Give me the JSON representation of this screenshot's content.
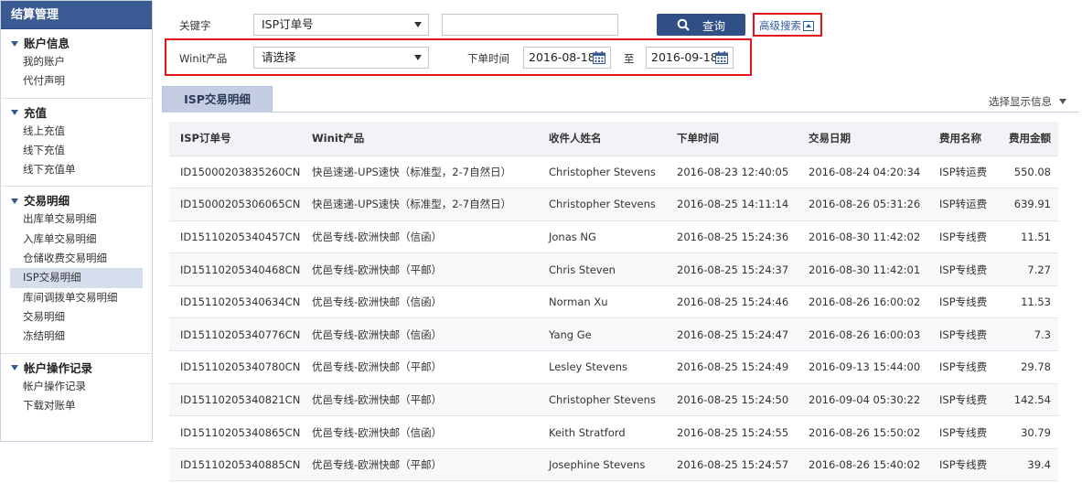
{
  "sidebar": {
    "title": "结算管理",
    "groups": [
      {
        "title": "账户信息",
        "items": [
          "我的账户",
          "代付声明"
        ]
      },
      {
        "title": "充值",
        "items": [
          "线上充值",
          "线下充值",
          "线下充值单"
        ]
      },
      {
        "title": "交易明细",
        "items": [
          "出库单交易明细",
          "入库单交易明细",
          "仓储收费交易明细",
          "ISP交易明细",
          "库间调拨单交易明细",
          "交易明细",
          "冻结明细"
        ]
      },
      {
        "title": "帐户操作记录",
        "items": [
          "帐户操作记录",
          "下载对账单"
        ]
      }
    ],
    "active_item": "ISP交易明细"
  },
  "filters": {
    "keyword_label": "关键字",
    "keyword_select": "ISP订单号",
    "keyword_value": "",
    "search_button": "查询",
    "advanced_search": "高级搜索",
    "product_label": "Winit产品",
    "product_select": "请选择",
    "order_time_label": "下单时间",
    "date_from": "2016-08-18",
    "to_label": "至",
    "date_to": "2016-09-18"
  },
  "tabs": {
    "active": "ISP交易明细",
    "display_info": "选择显示信息"
  },
  "table": {
    "columns": [
      "ISP订单号",
      "Winit产品",
      "收件人姓名",
      "下单时间",
      "交易日期",
      "费用名称",
      "费用金额"
    ],
    "rows": [
      [
        "ID15000203835260CN",
        "快邑速递-UPS速快（标准型，2-7自然日）",
        "Christopher Stevens",
        "2016-08-23 12:40:05",
        "2016-08-24 04:20:34",
        "ISP转运费",
        "550.08"
      ],
      [
        "ID15000205306065CN",
        "快邑速递-UPS速快（标准型，2-7自然日）",
        "Christopher Stevens",
        "2016-08-25 14:11:14",
        "2016-08-26 05:31:26",
        "ISP转运费",
        "639.91"
      ],
      [
        "ID15110205340457CN",
        "优邑专线-欧洲快邮（信函）",
        "Jonas NG",
        "2016-08-25 15:24:36",
        "2016-08-30 11:42:02",
        "ISP专线费",
        "11.51"
      ],
      [
        "ID15110205340468CN",
        "优邑专线-欧洲快邮（平邮）",
        "Chris Steven",
        "2016-08-25 15:24:37",
        "2016-08-30 11:42:01",
        "ISP专线费",
        "7.27"
      ],
      [
        "ID15110205340634CN",
        "优邑专线-欧洲快邮（信函）",
        "Norman Xu",
        "2016-08-25 15:24:46",
        "2016-08-26 16:00:02",
        "ISP专线费",
        "11.53"
      ],
      [
        "ID15110205340776CN",
        "优邑专线-欧洲快邮（信函）",
        "Yang Ge",
        "2016-08-25 15:24:47",
        "2016-08-26 16:00:03",
        "ISP专线费",
        "7.3"
      ],
      [
        "ID15110205340780CN",
        "优邑专线-欧洲快邮（平邮）",
        "Lesley Stevens",
        "2016-08-25 15:24:49",
        "2016-09-13 15:44:00",
        "ISP专线费",
        "29.78"
      ],
      [
        "ID15110205340821CN",
        "优邑专线-欧洲快邮（平邮）",
        "Christopher Stevens",
        "2016-08-25 15:24:50",
        "2016-09-04 05:30:22",
        "ISP专线费",
        "142.54"
      ],
      [
        "ID15110205340865CN",
        "优邑专线-欧洲快邮（信函）",
        "Keith Stratford",
        "2016-08-25 15:24:55",
        "2016-08-26 15:50:02",
        "ISP专线费",
        "30.79"
      ],
      [
        "ID15110205340885CN",
        "优邑专线-欧洲快邮（平邮）",
        "Josephine Stevens",
        "2016-08-25 15:24:57",
        "2016-08-26 15:40:02",
        "ISP专线费",
        "39.4"
      ]
    ]
  },
  "colors": {
    "brand": "#3a5a93",
    "highlight": "#e3141b",
    "link": "#2f5ba8"
  }
}
